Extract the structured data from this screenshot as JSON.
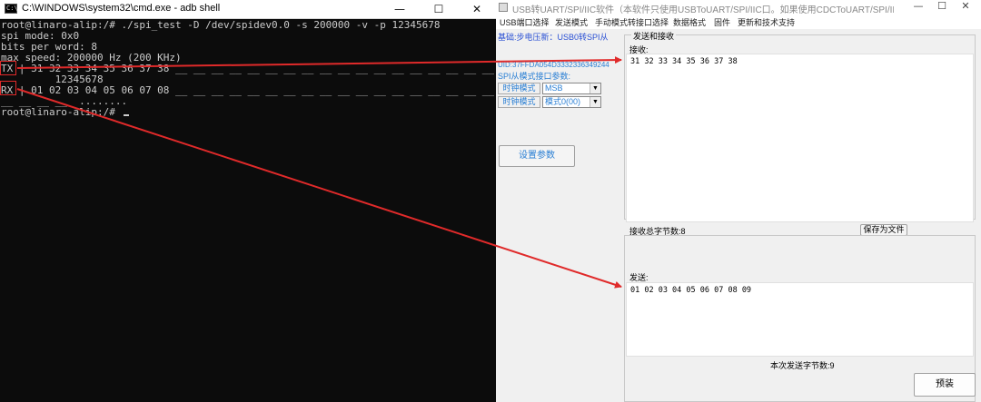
{
  "cmd": {
    "title": "C:\\WINDOWS\\system32\\cmd.exe - adb  shell",
    "icon_text": "C:\\",
    "window_buttons": {
      "minimize": "—",
      "maximize": "☐",
      "close": "✕"
    },
    "lines": [
      "root@linaro-alip:/# ./spi_test -D /dev/spidev0.0 -s 200000 -v -p 12345678",
      "spi mode: 0x0",
      "bits per word: 8",
      "max speed: 200000 Hz (200 KHz)",
      "TX | 31 32 33 34 35 36 37 38 __ __ __ __ __ __ __ __ __ __ __ __ __ __ __ __ __ __",
      "         12345678",
      "RX | 01 02 03 04 05 06 07 08 __ __ __ __ __ __ __ __ __ __ __ __ __ __ __ __ __ __",
      "__ __ __ __  ........",
      "root@linaro-alip:/# "
    ]
  },
  "app": {
    "title": "USB转UART/SPI/IIC软件（本软件只使用USBToUART/SPI/IIC口。如果使用CDCToUART/SPI/IIC口请使用普...",
    "window_buttons": {
      "minimize": "—",
      "maximize": "☐",
      "close": "✕"
    },
    "menu": [
      "USB端口选择",
      "发送模式",
      "手动模式转接口选择",
      "数据格式",
      "固件",
      "更新和技术支持"
    ],
    "left": {
      "status": "基础:步电压新：USB0转SPI从",
      "uid": "UID:37FFDA054D3332336349244",
      "section": "SPI从模式接口参数:",
      "clock_label": "时钟模式",
      "clock_value": "MSB",
      "bit_label": "时钟模式",
      "bit_value": "模式0(00)",
      "dropdown_arrow": "▼",
      "set_button": "设置参数"
    },
    "right": {
      "group_title": "发送和接收",
      "recv_label": "接收:",
      "recv_data": "31 32 33 34 35 36 37 38",
      "recv_total": "接收总字节数:8",
      "save_button": "保存为文件",
      "send_label": "发送:",
      "send_data": "01 02 03 04 05 06 07 08 09",
      "send_count": "本次发送字节数:9",
      "send_button": "预装"
    }
  },
  "colors": {
    "cmd_bg": "#0c0c0c",
    "cmd_text": "#cccccc",
    "arrow": "#e02a2a",
    "link_blue": "#2a7fd4"
  }
}
